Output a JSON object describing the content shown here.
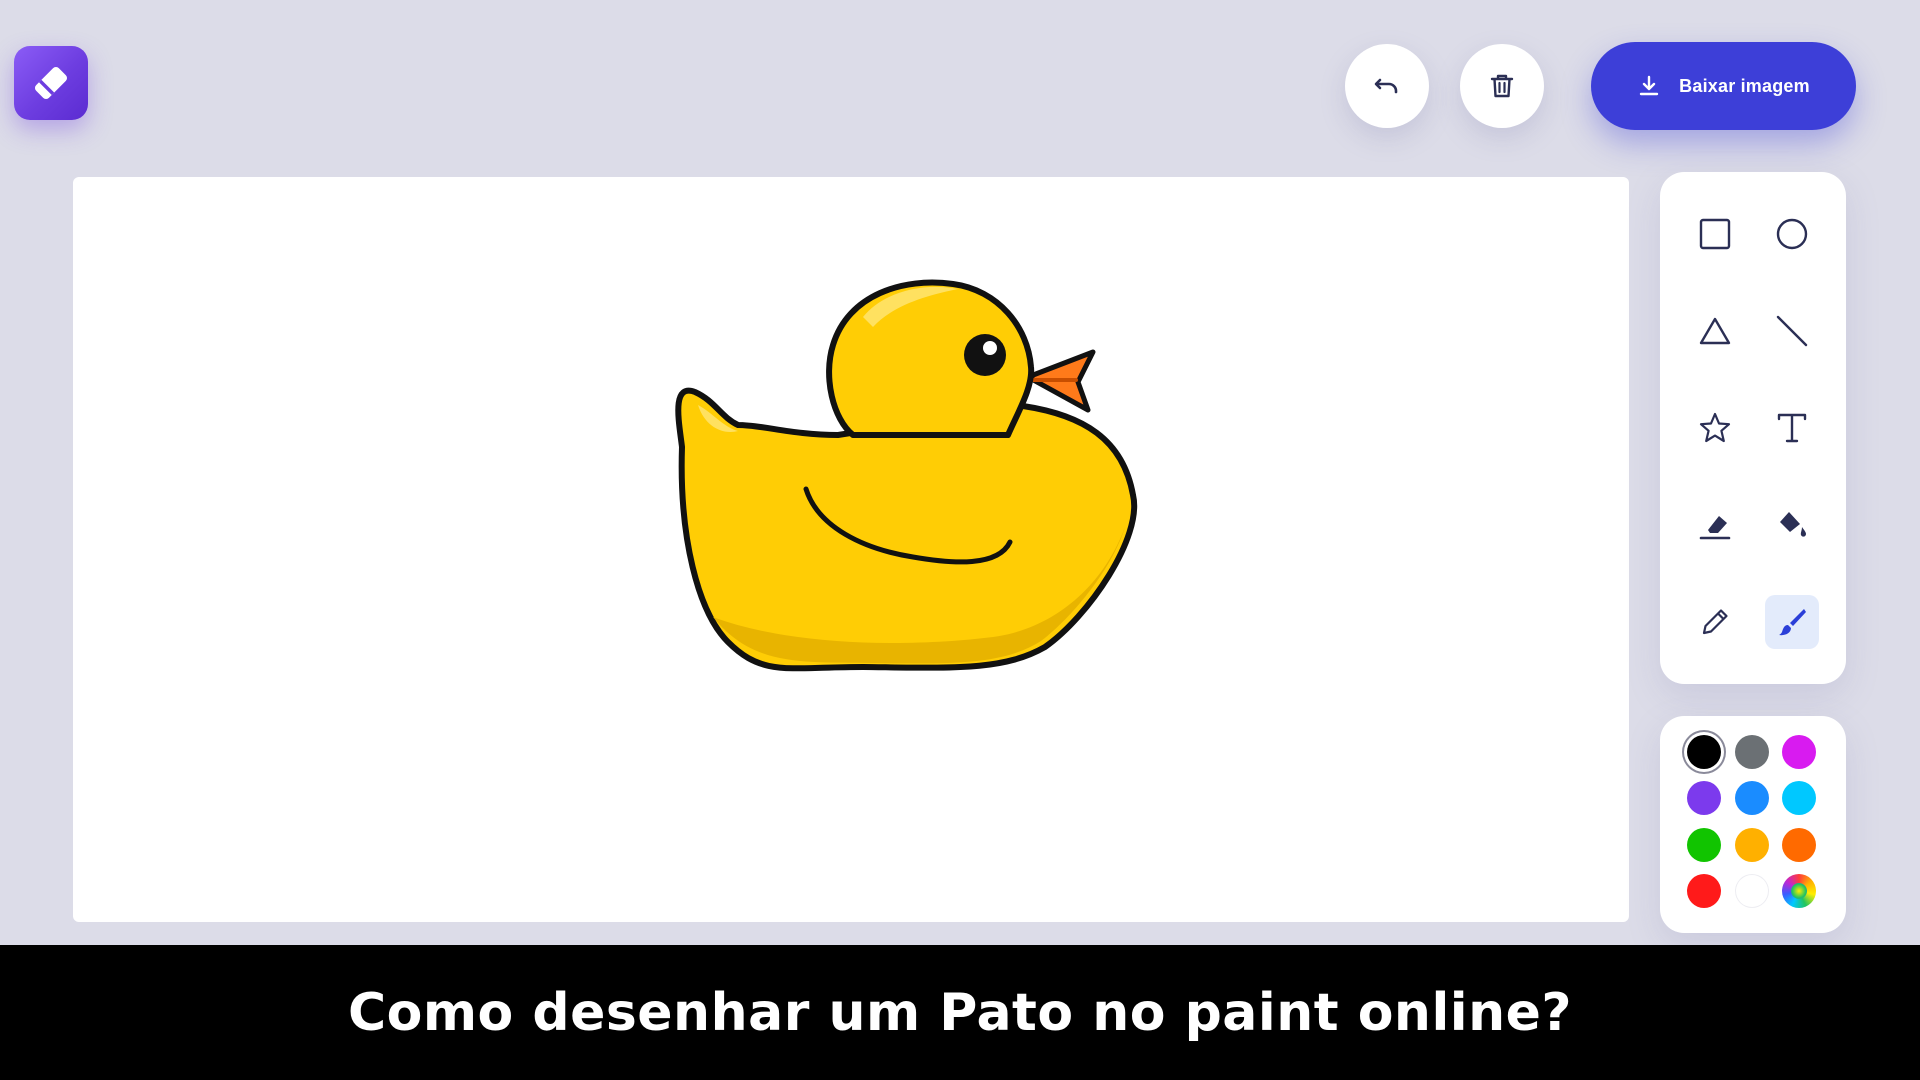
{
  "header": {
    "logo_icon": "pencil-eraser-logo-icon",
    "undo_icon": "undo-icon",
    "trash_icon": "trash-icon",
    "download_icon": "download-icon",
    "download_label": "Baixar imagem"
  },
  "canvas": {
    "drawing": "yellow rubber duck"
  },
  "tools": {
    "items": [
      {
        "icon": "square-icon",
        "active": false
      },
      {
        "icon": "circle-icon",
        "active": false
      },
      {
        "icon": "triangle-icon",
        "active": false
      },
      {
        "icon": "line-icon",
        "active": false
      },
      {
        "icon": "star-icon",
        "active": false
      },
      {
        "icon": "text-icon",
        "active": false
      },
      {
        "icon": "eraser-icon",
        "active": false
      },
      {
        "icon": "paint-bucket-icon",
        "active": false
      },
      {
        "icon": "pencil-icon",
        "active": false
      },
      {
        "icon": "brush-icon",
        "active": true
      }
    ]
  },
  "colors": {
    "selected": "#000000",
    "swatches": [
      "#000000",
      "#6b7074",
      "#d81bf0",
      "#7c3aed",
      "#1a8cff",
      "#00c8ff",
      "#11c400",
      "#ffb000",
      "#ff6a00",
      "#ff1a1a",
      "#ffffff",
      "rainbow"
    ]
  },
  "caption": {
    "text": "Como desenhar um Pato no paint online?"
  }
}
